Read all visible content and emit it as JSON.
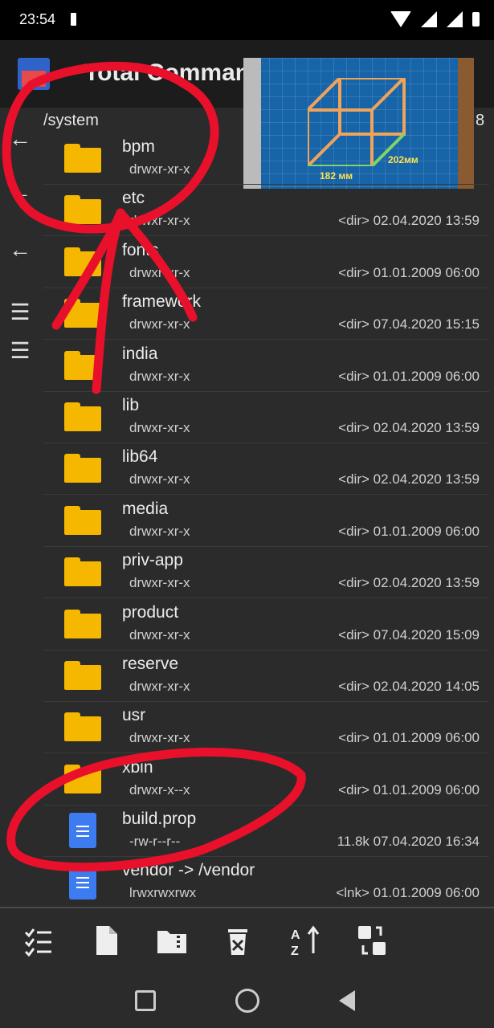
{
  "status_bar": {
    "time": "23:54"
  },
  "app": {
    "title": "Total Commander"
  },
  "ad": {
    "dimension_1": "182 мм",
    "dimension_2": "202мм"
  },
  "panel": {
    "path": "/system",
    "path_right": "8",
    "rows": [
      {
        "name": "bpm",
        "perm": "drwxr-xr-x",
        "meta": "",
        "type": "folder"
      },
      {
        "name": "etc",
        "perm": "drwxr-xr-x",
        "meta": "<dir>  02.04.2020  13:59",
        "type": "folder"
      },
      {
        "name": "fonts",
        "perm": "drwxr-xr-x",
        "meta": "<dir>  01.01.2009  06:00",
        "type": "folder"
      },
      {
        "name": "framework",
        "perm": "drwxr-xr-x",
        "meta": "<dir>  07.04.2020  15:15",
        "type": "folder"
      },
      {
        "name": "india",
        "perm": "drwxr-xr-x",
        "meta": "<dir>  01.01.2009  06:00",
        "type": "folder"
      },
      {
        "name": "lib",
        "perm": "drwxr-xr-x",
        "meta": "<dir>  02.04.2020  13:59",
        "type": "folder"
      },
      {
        "name": "lib64",
        "perm": "drwxr-xr-x",
        "meta": "<dir>  02.04.2020  13:59",
        "type": "folder"
      },
      {
        "name": "media",
        "perm": "drwxr-xr-x",
        "meta": "<dir>  01.01.2009  06:00",
        "type": "folder"
      },
      {
        "name": "priv-app",
        "perm": "drwxr-xr-x",
        "meta": "<dir>  02.04.2020  13:59",
        "type": "folder"
      },
      {
        "name": "product",
        "perm": "drwxr-xr-x",
        "meta": "<dir>  07.04.2020  15:09",
        "type": "folder"
      },
      {
        "name": "reserve",
        "perm": "drwxr-xr-x",
        "meta": "<dir>  02.04.2020  14:05",
        "type": "folder"
      },
      {
        "name": "usr",
        "perm": "drwxr-xr-x",
        "meta": "<dir>  01.01.2009  06:00",
        "type": "folder"
      },
      {
        "name": "xbin",
        "perm": "drwxr-x--x",
        "meta": "<dir>  01.01.2009  06:00",
        "type": "folder"
      },
      {
        "name": "build.prop",
        "perm": "-rw-r--r--",
        "meta": "11.8k  07.04.2020  16:34",
        "type": "file"
      },
      {
        "name": "vendor -> /vendor",
        "perm": "lrwxrwxrwx",
        "meta": "<lnk>  01.01.2009  06:00",
        "type": "file"
      }
    ]
  },
  "left_buttons": [
    "←",
    "←",
    "←",
    "☰",
    "☰"
  ],
  "toolbar_icons": [
    "select-icon",
    "new-file-icon",
    "zip-icon",
    "delete-icon",
    "sort-icon",
    "swap-panels-icon"
  ],
  "colors": {
    "folder": "#f6b700",
    "file": "#3d7bf0",
    "annotation": "#e8102a",
    "panel": "#2b2b2b"
  }
}
